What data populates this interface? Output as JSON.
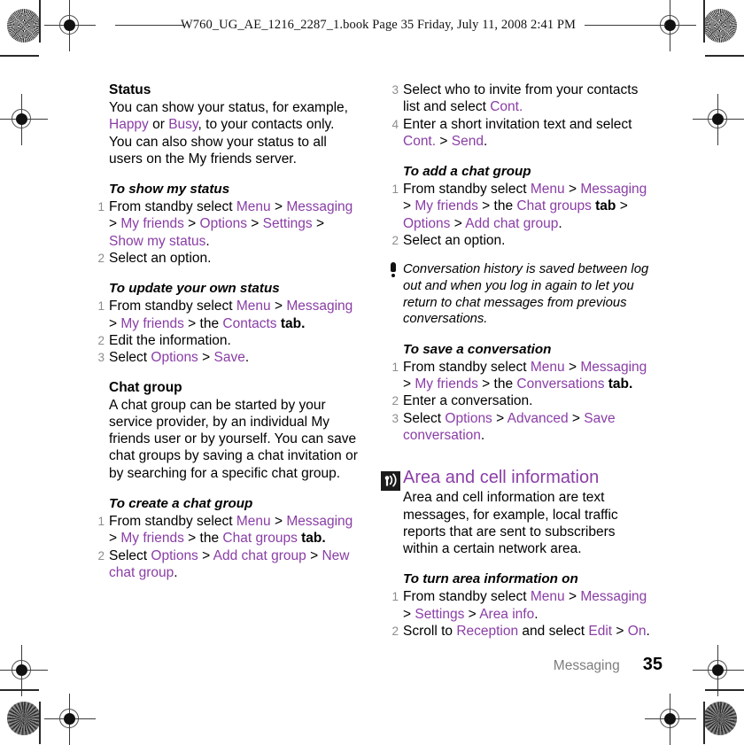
{
  "header": {
    "line": "W760_UG_AE_1216_2287_1.book  Page 35  Friday, July 11, 2008  2:41 PM"
  },
  "colors": {
    "accent_violet": "#8a3ea6",
    "step_number_gray": "#8d8d8d",
    "footer_gray": "#7d7d7d",
    "icon_dark": "#1b1b1b"
  },
  "left_column": {
    "status_heading": "Status",
    "status_para": {
      "p1": "You can show your status, for example, ",
      "v1": "Happy",
      "p2": " or ",
      "v2": "Busy",
      "p3": ", to your contacts only. You can also show your status to all users on the My friends server."
    },
    "proc_show_status": {
      "title": "To show my status",
      "steps": [
        {
          "num": "1",
          "parts": [
            {
              "text": "From standby select ",
              "style": "plain"
            },
            {
              "text": "Menu",
              "style": "violet"
            },
            {
              "text": " > ",
              "style": "plain"
            },
            {
              "text": "Messaging",
              "style": "violet"
            },
            {
              "text": " > ",
              "style": "plain"
            },
            {
              "text": "My friends",
              "style": "violet"
            },
            {
              "text": " > ",
              "style": "plain"
            },
            {
              "text": "Options",
              "style": "violet"
            },
            {
              "text": " > ",
              "style": "plain"
            },
            {
              "text": "Settings",
              "style": "violet"
            },
            {
              "text": " > ",
              "style": "plain"
            },
            {
              "text": "Show my status",
              "style": "violet"
            },
            {
              "text": ".",
              "style": "plain"
            }
          ]
        },
        {
          "num": "2",
          "parts": [
            {
              "text": "Select an option.",
              "style": "plain"
            }
          ]
        }
      ]
    },
    "proc_update_status": {
      "title": "To update your own status",
      "steps": [
        {
          "num": "1",
          "parts": [
            {
              "text": "From standby select ",
              "style": "plain"
            },
            {
              "text": "Menu",
              "style": "violet"
            },
            {
              "text": " > ",
              "style": "plain"
            },
            {
              "text": "Messaging",
              "style": "violet"
            },
            {
              "text": " > ",
              "style": "plain"
            },
            {
              "text": "My friends",
              "style": "violet"
            },
            {
              "text": " > the ",
              "style": "plain"
            },
            {
              "text": "Contacts",
              "style": "violet"
            },
            {
              "text": " tab.",
              "style": "bold"
            }
          ]
        },
        {
          "num": "2",
          "parts": [
            {
              "text": "Edit the information.",
              "style": "plain"
            }
          ]
        },
        {
          "num": "3",
          "parts": [
            {
              "text": "Select ",
              "style": "plain"
            },
            {
              "text": "Options",
              "style": "violet"
            },
            {
              "text": " > ",
              "style": "plain"
            },
            {
              "text": "Save",
              "style": "violet"
            },
            {
              "text": ".",
              "style": "plain"
            }
          ]
        }
      ]
    },
    "chat_group_heading": "Chat group",
    "chat_group_para": "A chat group can be started by your service provider, by an individual My friends user or by yourself. You can save chat groups by saving a chat invitation or by searching for a specific chat group.",
    "proc_create_chat_group": {
      "title": "To create a chat group",
      "steps": [
        {
          "num": "1",
          "parts": [
            {
              "text": "From standby select ",
              "style": "plain"
            },
            {
              "text": "Menu",
              "style": "violet"
            },
            {
              "text": " > ",
              "style": "plain"
            },
            {
              "text": "Messaging",
              "style": "violet"
            },
            {
              "text": " > ",
              "style": "plain"
            },
            {
              "text": "My friends",
              "style": "violet"
            },
            {
              "text": " > the ",
              "style": "plain"
            },
            {
              "text": "Chat groups",
              "style": "violet"
            },
            {
              "text": " tab.",
              "style": "bold"
            }
          ]
        },
        {
          "num": "2",
          "parts": [
            {
              "text": "Select ",
              "style": "plain"
            },
            {
              "text": "Options",
              "style": "violet"
            },
            {
              "text": " > ",
              "style": "plain"
            },
            {
              "text": "Add chat group",
              "style": "violet"
            },
            {
              "text": " > ",
              "style": "plain"
            },
            {
              "text": "New chat group",
              "style": "violet"
            },
            {
              "text": ".",
              "style": "plain"
            }
          ]
        }
      ]
    }
  },
  "right_column": {
    "continued_steps": [
      {
        "num": "3",
        "parts": [
          {
            "text": "Select who to invite from your contacts list and select ",
            "style": "plain"
          },
          {
            "text": "Cont.",
            "style": "violet"
          }
        ]
      },
      {
        "num": "4",
        "parts": [
          {
            "text": "Enter a short invitation text and select ",
            "style": "plain"
          },
          {
            "text": "Cont.",
            "style": "violet"
          },
          {
            "text": " > ",
            "style": "plain"
          },
          {
            "text": "Send",
            "style": "violet"
          },
          {
            "text": ".",
            "style": "plain"
          }
        ]
      }
    ],
    "proc_add_chat_group": {
      "title": "To add a chat group",
      "steps": [
        {
          "num": "1",
          "parts": [
            {
              "text": "From standby select ",
              "style": "plain"
            },
            {
              "text": "Menu",
              "style": "violet"
            },
            {
              "text": " > ",
              "style": "plain"
            },
            {
              "text": "Messaging",
              "style": "violet"
            },
            {
              "text": " > ",
              "style": "plain"
            },
            {
              "text": "My friends",
              "style": "violet"
            },
            {
              "text": " > the ",
              "style": "plain"
            },
            {
              "text": "Chat groups",
              "style": "violet"
            },
            {
              "text": " tab",
              "style": "bold"
            },
            {
              "text": " > ",
              "style": "plain"
            },
            {
              "text": "Options",
              "style": "violet"
            },
            {
              "text": " > ",
              "style": "plain"
            },
            {
              "text": "Add chat group",
              "style": "violet"
            },
            {
              "text": ".",
              "style": "plain"
            }
          ]
        },
        {
          "num": "2",
          "parts": [
            {
              "text": "Select an option.",
              "style": "plain"
            }
          ]
        }
      ]
    },
    "note": {
      "icon": "exclamation-icon",
      "text": "Conversation history is saved between log out and when you log in again to let you return to chat messages from previous conversations."
    },
    "proc_save_conversation": {
      "title": "To save a conversation",
      "steps": [
        {
          "num": "1",
          "parts": [
            {
              "text": "From standby select ",
              "style": "plain"
            },
            {
              "text": "Menu",
              "style": "violet"
            },
            {
              "text": " > ",
              "style": "plain"
            },
            {
              "text": "Messaging",
              "style": "violet"
            },
            {
              "text": " > ",
              "style": "plain"
            },
            {
              "text": "My friends",
              "style": "violet"
            },
            {
              "text": " > the ",
              "style": "plain"
            },
            {
              "text": "Conversations",
              "style": "violet"
            },
            {
              "text": " tab.",
              "style": "bold"
            }
          ]
        },
        {
          "num": "2",
          "parts": [
            {
              "text": "Enter a conversation.",
              "style": "plain"
            }
          ]
        },
        {
          "num": "3",
          "parts": [
            {
              "text": "Select ",
              "style": "plain"
            },
            {
              "text": "Options",
              "style": "violet"
            },
            {
              "text": " > ",
              "style": "plain"
            },
            {
              "text": "Advanced",
              "style": "violet"
            },
            {
              "text": " > ",
              "style": "plain"
            },
            {
              "text": "Save conversation",
              "style": "violet"
            },
            {
              "text": ".",
              "style": "plain"
            }
          ]
        }
      ]
    },
    "section": {
      "icon": "broadcast-antenna-icon",
      "title": "Area and cell information",
      "para": "Area and cell information are text messages, for example, local traffic reports that are sent to subscribers within a certain network area."
    },
    "proc_turn_area_info_on": {
      "title": "To turn area information on",
      "steps": [
        {
          "num": "1",
          "parts": [
            {
              "text": "From standby select ",
              "style": "plain"
            },
            {
              "text": "Menu",
              "style": "violet"
            },
            {
              "text": " > ",
              "style": "plain"
            },
            {
              "text": "Messaging",
              "style": "violet"
            },
            {
              "text": " > ",
              "style": "plain"
            },
            {
              "text": "Settings",
              "style": "violet"
            },
            {
              "text": " > ",
              "style": "plain"
            },
            {
              "text": "Area info",
              "style": "violet"
            },
            {
              "text": ".",
              "style": "plain"
            }
          ]
        },
        {
          "num": "2",
          "parts": [
            {
              "text": "Scroll to ",
              "style": "plain"
            },
            {
              "text": "Reception",
              "style": "violet"
            },
            {
              "text": " and select ",
              "style": "plain"
            },
            {
              "text": "Edit",
              "style": "violet"
            },
            {
              "text": " > ",
              "style": "plain"
            },
            {
              "text": "On",
              "style": "violet"
            },
            {
              "text": ".",
              "style": "plain"
            }
          ]
        }
      ]
    }
  },
  "footer": {
    "chapter": "Messaging",
    "page_number": "35"
  }
}
